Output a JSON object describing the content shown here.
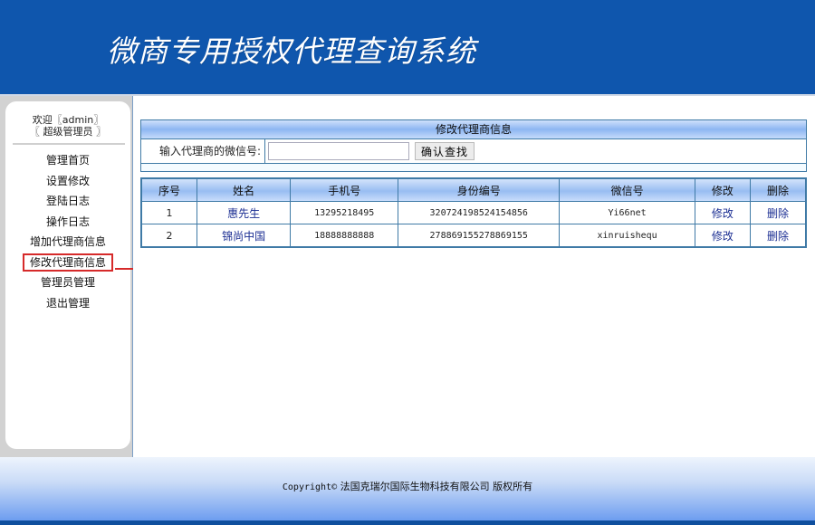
{
  "header": {
    "title": "微商专用授权代理查询系统"
  },
  "sidebar": {
    "welcome_line1": "欢迎〖admin〗",
    "welcome_line2": "〖 超级管理员 〗",
    "items": [
      {
        "label": "管理首页"
      },
      {
        "label": "设置修改"
      },
      {
        "label": "登陆日志"
      },
      {
        "label": "操作日志"
      },
      {
        "label": "增加代理商信息"
      },
      {
        "label": "修改代理商信息",
        "active": true
      },
      {
        "label": "管理员管理"
      },
      {
        "label": "退出管理"
      }
    ],
    "highlight_color": "#d62a2a"
  },
  "panel": {
    "title": "修改代理商信息",
    "search_label": "输入代理商的微信号:",
    "search_value": "",
    "search_placeholder": "",
    "search_button": "确认查找"
  },
  "table": {
    "headers": [
      "序号",
      "姓名",
      "手机号",
      "身份编号",
      "微信号",
      "修改",
      "删除"
    ],
    "rows": [
      {
        "index": "1",
        "name": "惠先生",
        "phone": "13295218495",
        "id_number": "320724198524154856",
        "wechat": "Yi66net",
        "edit": "修改",
        "delete": "删除"
      },
      {
        "index": "2",
        "name": "锦尚中国",
        "phone": "18888888888",
        "id_number": "278869155278869155",
        "wechat": "xinruishequ",
        "edit": "修改",
        "delete": "删除"
      }
    ]
  },
  "footer": {
    "copyright_en": "Copyright©",
    "copyright_cn": "法国克瑞尔国际生物科技有限公司 版权所有"
  },
  "colors": {
    "header_bg": "#0f56ad",
    "link": "#1c2f93",
    "border": "#3f7aa6"
  }
}
